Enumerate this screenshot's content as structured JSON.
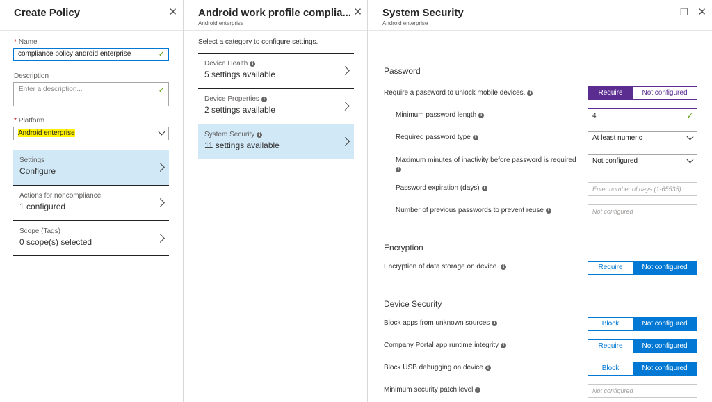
{
  "blade1": {
    "title": "Create Policy",
    "name_label": "Name",
    "name_value": "compliance policy android enterprise",
    "description_label": "Description",
    "description_placeholder": "Enter a description...",
    "platform_label": "Platform",
    "platform_value": "Android enterprise",
    "items": [
      {
        "label": "Settings",
        "value": "Configure"
      },
      {
        "label": "Actions for noncompliance",
        "value": "1 configured"
      },
      {
        "label": "Scope (Tags)",
        "value": "0 scope(s) selected"
      }
    ]
  },
  "blade2": {
    "title": "Android work profile complia...",
    "subtitle": "Android enterprise",
    "hint": "Select a category to configure settings.",
    "categories": [
      {
        "label": "Device Health",
        "value": "5 settings available"
      },
      {
        "label": "Device Properties",
        "value": "2 settings available"
      },
      {
        "label": "System Security",
        "value": "11 settings available"
      }
    ]
  },
  "blade3": {
    "title": "System Security",
    "subtitle": "Android enterprise",
    "password": {
      "section": "Password",
      "require_password_label": "Require a password to unlock mobile devices.",
      "require_password_on": "Require",
      "require_password_off": "Not configured",
      "min_length_label": "Minimum password length",
      "min_length_value": "4",
      "type_label": "Required password type",
      "type_value": "At least numeric",
      "inactivity_label_line1": "Maximum minutes of inactivity before password is required",
      "inactivity_value": "Not configured",
      "expiration_label": "Password expiration (days)",
      "expiration_placeholder": "Enter number of days (1-65535)",
      "reuse_label": "Number of previous passwords to prevent reuse",
      "reuse_placeholder": "Not configured"
    },
    "encryption": {
      "section": "Encryption",
      "storage_label": "Encryption of data storage on device.",
      "storage_left": "Require",
      "storage_right": "Not configured"
    },
    "device_security": {
      "section": "Device Security",
      "unknown_sources_label": "Block apps from unknown sources",
      "unknown_sources_left": "Block",
      "unknown_sources_right": "Not configured",
      "portal_label": "Company Portal app runtime integrity",
      "portal_left": "Require",
      "portal_right": "Not configured",
      "usb_label": "Block USB debugging on device",
      "usb_left": "Block",
      "usb_right": "Not configured",
      "patch_label": "Minimum security patch level",
      "patch_placeholder": "Not configured"
    }
  },
  "icons": {
    "close": "✕",
    "maximize": "☐",
    "info": "i",
    "check": "✓"
  }
}
